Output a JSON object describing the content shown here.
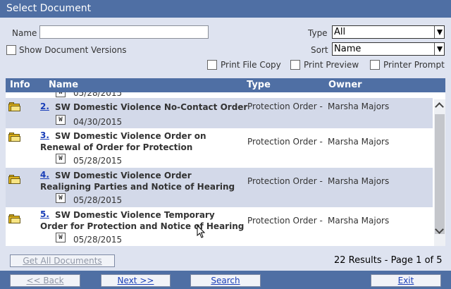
{
  "window": {
    "title": "Select Document"
  },
  "filters": {
    "name_label": "Name",
    "name_value": "",
    "type_label": "Type",
    "type_value": "All",
    "sort_label": "Sort",
    "sort_value": "Name",
    "show_versions_label": "Show Document Versions",
    "print_file_copy_label": "Print File Copy",
    "print_preview_label": "Print Preview",
    "printer_prompt_label": "Printer Prompt"
  },
  "grid": {
    "columns": {
      "info": "Info",
      "name": "Name",
      "type": "Type",
      "owner": "Owner"
    },
    "partial_row_date": "05/28/2015",
    "rows": [
      {
        "number": "2.",
        "title": "SW Domestic Violence No-Contact Order",
        "date": "04/30/2015",
        "type": "Protection Order - N",
        "owner": "Marsha Majors"
      },
      {
        "number": "3.",
        "title": "SW Domestic Violence Order on Renewal of Order for Protection",
        "date": "05/28/2015",
        "type": "Protection Order - N",
        "owner": "Marsha Majors"
      },
      {
        "number": "4.",
        "title": "SW Domestic Violence Order Realigning Parties and Notice of Hearing",
        "date": "05/28/2015",
        "type": "Protection Order - N",
        "owner": "Marsha Majors"
      },
      {
        "number": "5.",
        "title": "SW Domestic Violence Temporary Order for Protection and Notice of Hearing",
        "date": "05/28/2015",
        "type": "Protection Order - N",
        "owner": "Marsha Majors"
      }
    ],
    "word_icon_letter": "W"
  },
  "actions": {
    "get_all_label": "Get All Documents",
    "results_text": "22 Results - Page 1 of 5",
    "back_label": "<< Back",
    "next_label": "Next >>",
    "search_label": "Search",
    "exit_label": "Exit"
  }
}
